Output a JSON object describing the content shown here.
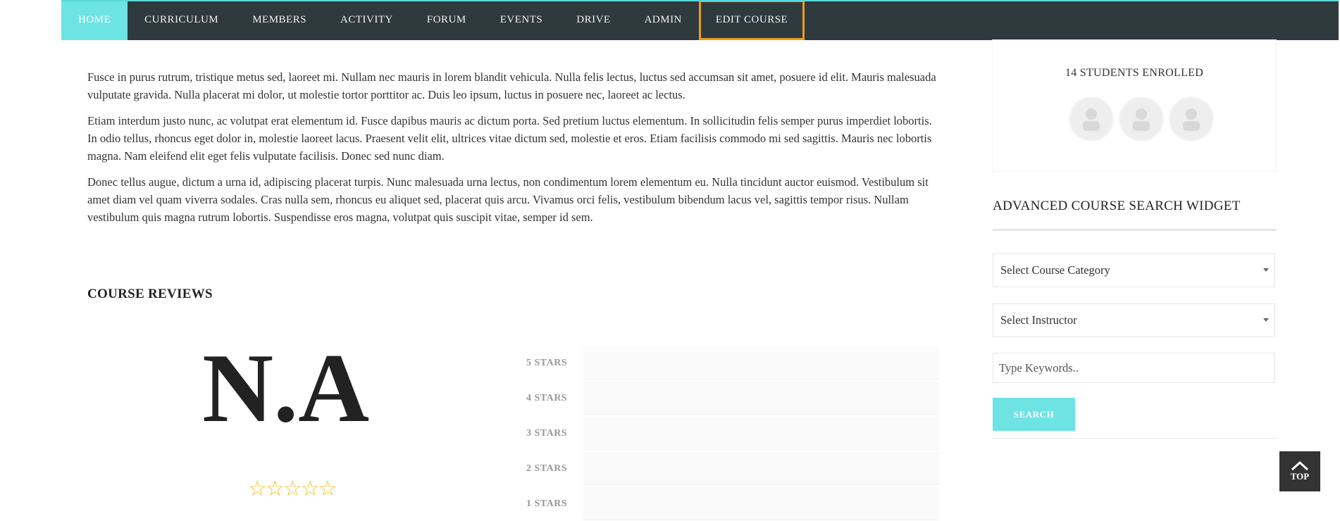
{
  "nav": {
    "items": [
      {
        "label": "HOME"
      },
      {
        "label": "CURRICULUM"
      },
      {
        "label": "MEMBERS"
      },
      {
        "label": "ACTIVITY"
      },
      {
        "label": "FORUM"
      },
      {
        "label": "EVENTS"
      },
      {
        "label": "DRIVE"
      },
      {
        "label": "ADMIN"
      },
      {
        "label": "EDIT COURSE"
      }
    ],
    "active": "HOME",
    "highlighted": "EDIT COURSE"
  },
  "content": {
    "paragraphs": [
      "Fusce in purus rutrum, tristique metus sed, laoreet mi. Nullam nec mauris in lorem blandit vehicula. Nulla felis lectus, luctus sed accumsan sit amet, posuere id elit. Mauris malesuada vulputate gravida. Nulla placerat mi dolor, ut molestie tortor porttitor ac. Duis leo ipsum, luctus in posuere nec, laoreet ac lectus.",
      "Etiam interdum justo nunc, ac volutpat erat elementum id. Fusce dapibus mauris ac dictum porta. Sed pretium luctus elementum. In sollicitudin felis semper purus imperdiet lobortis. In odio tellus, rhoncus eget dolor in, molestie laoreet lacus. Praesent velit elit, ultrices vitae dictum sed, molestie et eros. Etiam facilisis commodo mi sed sagittis. Mauris nec lobortis magna. Nam eleifend elit eget felis vulputate facilisis. Donec sed nunc diam.",
      "Donec tellus augue, dictum a urna id, adipiscing placerat turpis. Nunc malesuada urna lectus, non condimentum lorem elementum eu. Nulla tincidunt auctor euismod. Vestibulum sit amet diam vel quam viverra sodales. Cras nulla sem, rhoncus eu aliquet sed, placerat quis arcu. Vivamus orci felis, vestibulum bibendum lacus vel, sagittis tempor risus. Nullam vestibulum quis magna rutrum lobortis. Suspendisse eros magna, volutpat quis suscipit vitae, semper id sem."
    ]
  },
  "reviews": {
    "title": "COURSE REVIEWS",
    "average": "N.A",
    "stars_filled": 0,
    "stars_total": 5,
    "breakdown": [
      {
        "label": "5 STARS",
        "value": 0
      },
      {
        "label": "4 STARS",
        "value": 0
      },
      {
        "label": "3 STARS",
        "value": 0
      },
      {
        "label": "2 STARS",
        "value": 0
      },
      {
        "label": "1 STARS",
        "value": 0
      }
    ]
  },
  "sidebar": {
    "enrolled_text": "14 STUDENTS ENROLLED",
    "widget_title": "ADVANCED COURSE SEARCH WIDGET",
    "category_select": "Select Course Category",
    "instructor_select": "Select Instructor",
    "keywords_placeholder": "Type Keywords..",
    "search_label": "SEARCH"
  },
  "top_button": {
    "label": "TOP"
  },
  "colors": {
    "nav_bg": "#2e3a3e",
    "accent": "#6ee3e3",
    "highlight": "#f19a1c",
    "star": "#f2c22b"
  }
}
